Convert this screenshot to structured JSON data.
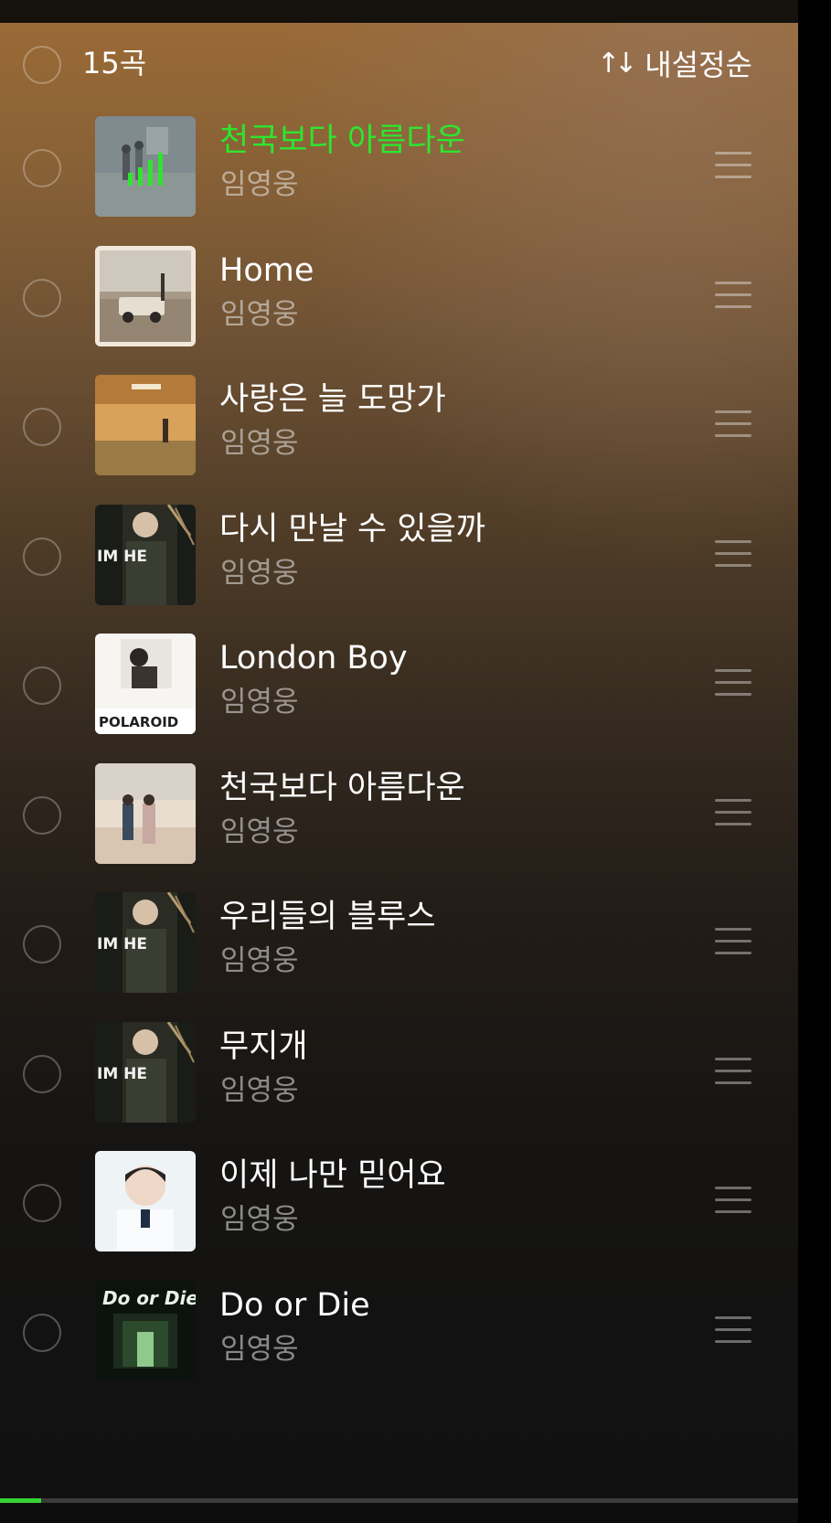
{
  "header": {
    "count_label": "15곡",
    "sort_label": "내설정순",
    "sort_icon": "↑↓"
  },
  "tracks": [
    {
      "title": "천국보다 아름다운",
      "artist": "임영웅",
      "playing": true,
      "cover": "blue-grey-couple"
    },
    {
      "title": "Home",
      "artist": "임영웅",
      "playing": false,
      "cover": "jeep-poster"
    },
    {
      "title": "사랑은 늘 도망가",
      "artist": "임영웅",
      "playing": false,
      "cover": "sunset-field"
    },
    {
      "title": "다시 만날 수 있을까",
      "artist": "임영웅",
      "playing": false,
      "cover": "im-hero",
      "cover_text": "IM HE"
    },
    {
      "title": "London Boy",
      "artist": "임영웅",
      "playing": false,
      "cover": "polaroid",
      "cover_text": "POLAROID"
    },
    {
      "title": "천국보다 아름다운",
      "artist": "임영웅",
      "playing": false,
      "cover": "beach-couple"
    },
    {
      "title": "우리들의 블루스",
      "artist": "임영웅",
      "playing": false,
      "cover": "im-hero",
      "cover_text": "IM HE"
    },
    {
      "title": "무지개",
      "artist": "임영웅",
      "playing": false,
      "cover": "im-hero",
      "cover_text": "IM HE"
    },
    {
      "title": "이제 나만 믿어요",
      "artist": "임영웅",
      "playing": false,
      "cover": "portrait-white"
    },
    {
      "title": "Do or Die",
      "artist": "임영웅",
      "playing": false,
      "cover": "do-or-die",
      "cover_text": "Do or Die"
    }
  ],
  "playback": {
    "progress_fraction": 0.052
  },
  "colors": {
    "playing_accent": "#2ee52e",
    "progress_accent": "#34d334"
  }
}
